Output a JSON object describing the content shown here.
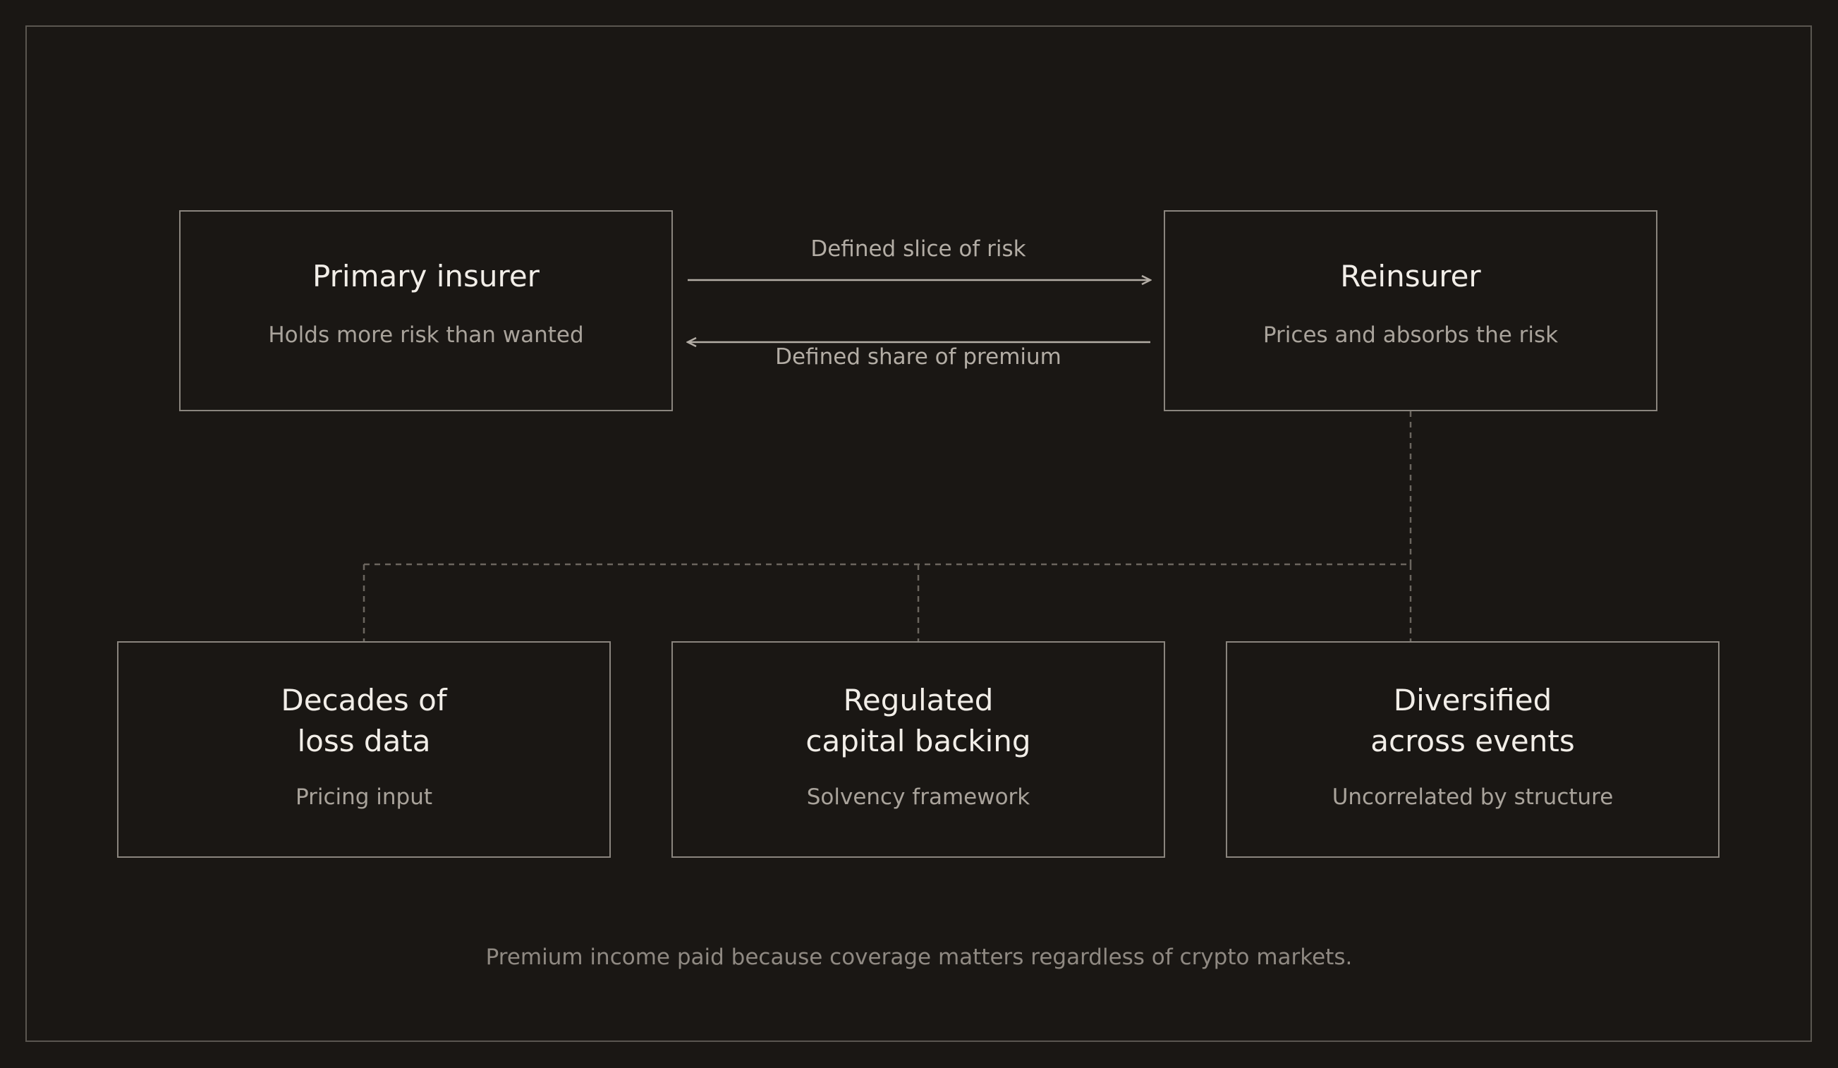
{
  "diagram": {
    "primary": {
      "title": "Primary insurer",
      "subtitle": "Holds more risk than wanted"
    },
    "reinsurer": {
      "title": "Reinsurer",
      "subtitle": "Prices and absorbs the risk"
    },
    "flows": {
      "to_reinsurer": "Defined slice of risk",
      "to_primary": "Defined share of premium"
    },
    "pillars": [
      {
        "title": "Decades of\nloss data",
        "subtitle": "Pricing input"
      },
      {
        "title": "Regulated\ncapital backing",
        "subtitle": "Solvency framework"
      },
      {
        "title": "Diversified\nacross events",
        "subtitle": "Uncorrelated by structure"
      }
    ],
    "footnote": "Premium income paid because coverage matters regardless of crypto markets."
  },
  "colors": {
    "background": "#1a1714",
    "box_border": "#8a857e",
    "frame_border": "#5a5650",
    "arrow": "#b3ada5",
    "dashed_connector": "#6b665f",
    "title_text": "#f2eee8",
    "subtitle_text": "#a9a39b"
  }
}
